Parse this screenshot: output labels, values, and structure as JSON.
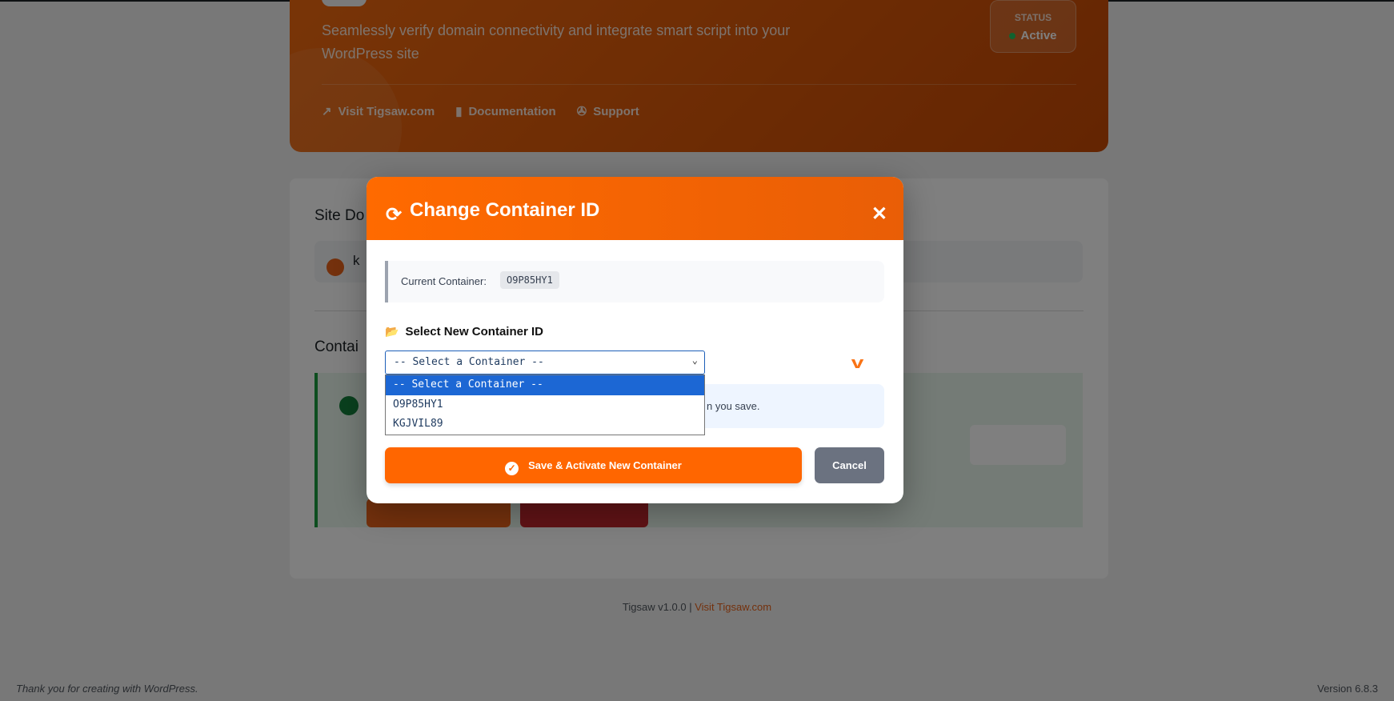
{
  "hero": {
    "description": "Seamlessly verify domain connectivity and integrate smart script into your WordPress site",
    "status_label": "STATUS",
    "status_value": "Active",
    "links": [
      {
        "icon": "external-link-icon",
        "label": "Visit Tigsaw.com"
      },
      {
        "icon": "book-icon",
        "label": "Documentation"
      },
      {
        "icon": "lifebuoy-icon",
        "label": "Support"
      }
    ]
  },
  "card": {
    "site_heading": "Site Do",
    "domain_prefix": "k",
    "container_heading": "Contai"
  },
  "modal": {
    "title": "Change Container ID",
    "current_label": "Current Container:",
    "current_value": "O9P85HY1",
    "select_label": "Select New Container ID",
    "select_value": "-- Select a Container --",
    "options": [
      "-- Select a Container --",
      "O9P85HY1",
      "KGJVIL89"
    ],
    "info_text": "n you save.",
    "save_label": "Save & Activate New Container",
    "cancel_label": "Cancel"
  },
  "footer": {
    "version": "Tigsaw v1.0.0 | ",
    "link": "Visit Tigsaw.com",
    "wp_thanks": "Thank you for creating with WordPress.",
    "wp_version": "Version 6.8.3"
  },
  "colors": {
    "accent": "#ff6600",
    "selected": "#1c67d4",
    "cancel": "#6b7280"
  }
}
